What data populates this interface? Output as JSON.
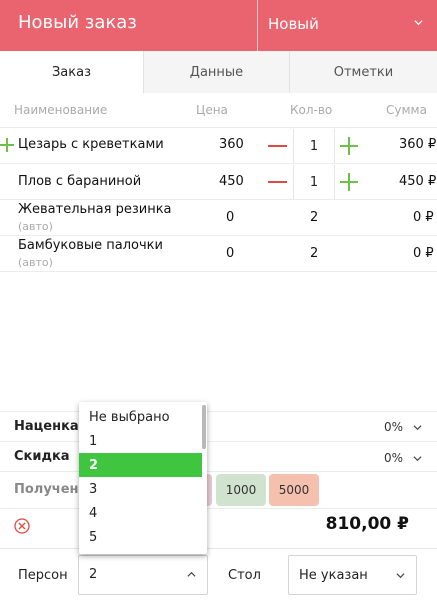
{
  "header": {
    "title": "Новый заказ",
    "status": "Новый",
    "color": "#ea6470"
  },
  "tabs": [
    {
      "label": "Заказ",
      "active": true
    },
    {
      "label": "Данные",
      "active": false
    },
    {
      "label": "Отметки",
      "active": false
    }
  ],
  "table": {
    "columns": [
      "Наименование",
      "Цена",
      "Кол-во",
      "Сумма"
    ],
    "rows": [
      {
        "name": "Цезарь с креветками",
        "price": "360",
        "qty": "1",
        "sum": "360 ₽",
        "sub": ""
      },
      {
        "name": "Плов с бараниной",
        "price": "450",
        "qty": "1",
        "sum": "450 ₽",
        "sub": ""
      },
      {
        "name": "Жевательная резинка",
        "price": "0",
        "qty": "2",
        "sum": "0 ₽",
        "sub": "(авто)"
      },
      {
        "name": "Бамбуковые палочки",
        "price": "0",
        "qty": "2",
        "sum": "0 ₽",
        "sub": "(авто)"
      }
    ]
  },
  "markup": {
    "label": "Наценка",
    "value": "0%"
  },
  "discount": {
    "label": "Скидка",
    "value": "0%"
  },
  "received": {
    "label": "Получено",
    "buttons": [
      "1000",
      "5000"
    ]
  },
  "total": "810,00 ₽",
  "footer": {
    "persons_label": "Персон",
    "persons_value": "2",
    "table_label": "Стол",
    "table_value": "Не указан"
  },
  "dropdown": {
    "options": [
      "Не выбрано",
      "1",
      "2",
      "3",
      "4",
      "5"
    ],
    "selected": "2"
  },
  "colors": {
    "accent": "#ea6470",
    "minus": "#e04a40",
    "plus": "#6dc04b",
    "selected": "#3fc53f",
    "btn_1000": "#cfe3cf",
    "btn_5000": "#f6c0ae"
  }
}
